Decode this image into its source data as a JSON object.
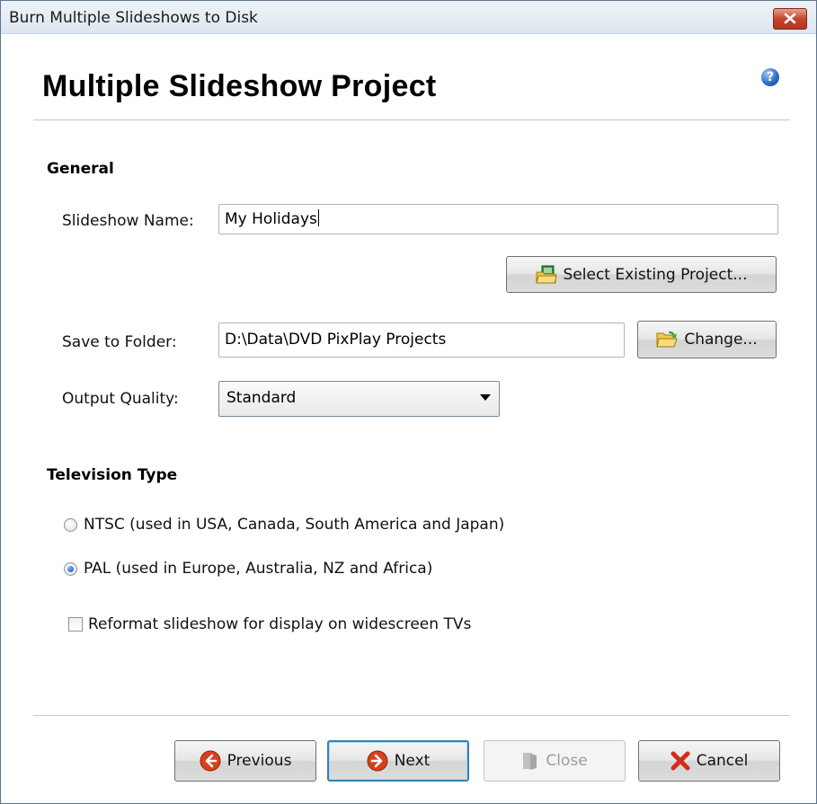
{
  "window": {
    "title": "Burn Multiple Slideshows to Disk"
  },
  "header": {
    "title": "Multiple Slideshow Project",
    "help_glyph": "?"
  },
  "general": {
    "heading": "General",
    "slideshow_name_label": "Slideshow Name:",
    "slideshow_name_value": "My Holidays",
    "select_existing_label": "Select Existing Project...",
    "save_folder_label": "Save to Folder:",
    "save_folder_value": "D:\\Data\\DVD PixPlay Projects",
    "change_label": "Change...",
    "output_quality_label": "Output Quality:",
    "output_quality_value": "Standard"
  },
  "television": {
    "heading": "Television Type",
    "ntsc_label": "NTSC (used in USA, Canada, South America and Japan)",
    "ntsc_checked": false,
    "pal_label": "PAL (used in Europe, Australia, NZ and Africa)",
    "pal_checked": true,
    "widescreen_label": "Reformat slideshow for display on widescreen TVs",
    "widescreen_checked": false
  },
  "footer": {
    "previous_label": "Previous",
    "next_label": "Next",
    "close_label": "Close",
    "cancel_label": "Cancel"
  },
  "icons": {
    "title_close": "close-x-icon",
    "help": "help-icon",
    "select_project": "project-folder-icon",
    "change_folder": "open-folder-icon",
    "previous": "back-arrow-icon",
    "next": "forward-arrow-icon",
    "close": "close-door-icon",
    "cancel": "red-x-icon"
  },
  "colors": {
    "title_close_bg": "#c4462f",
    "arrow_icon": "#d8401c",
    "default_button_border": "#3c7fb1",
    "cancel_x": "#d42a1a"
  }
}
